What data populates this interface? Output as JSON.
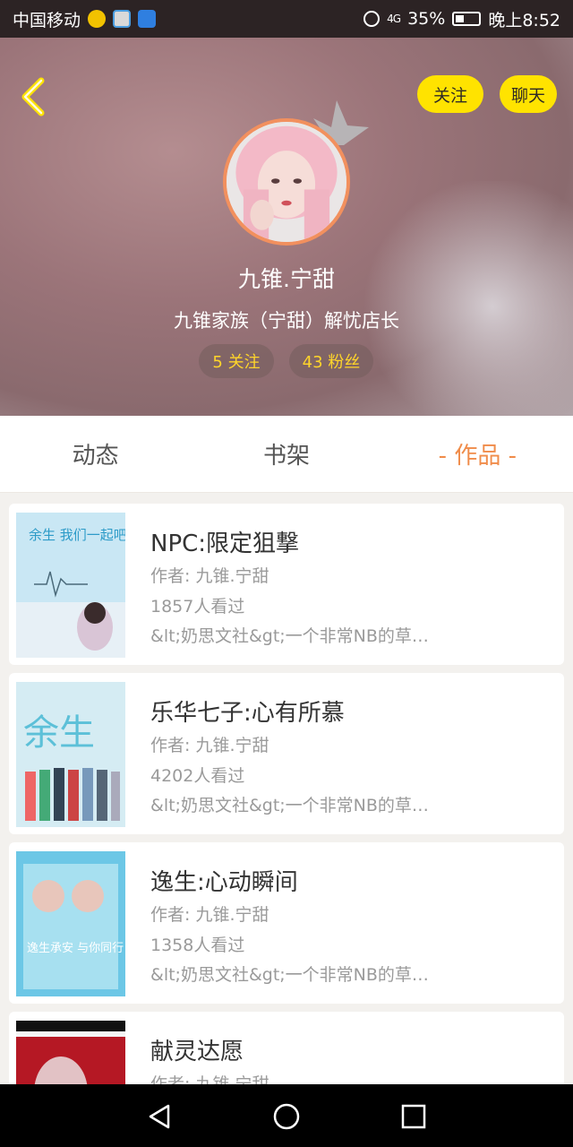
{
  "status_bar": {
    "carrier": "中国移动",
    "battery": "35%",
    "time": "晚上8:52",
    "network": "4G"
  },
  "header": {
    "follow_label": "关注",
    "chat_label": "聊天",
    "name": "九锥.宁甜",
    "title": "九锥家族（宁甜）解忧店长",
    "following": "5 关注",
    "fans": "43 粉丝"
  },
  "tabs": [
    "动态",
    "书架",
    "- 作品 -"
  ],
  "books": [
    {
      "title": "NPC:限定狙撃",
      "author": "作者: 九锥.宁甜",
      "views": "1857人看过",
      "desc": "&lt;奶思文社&gt;一个非常NB的草…",
      "cover_text": "余生 我们一起吧"
    },
    {
      "title": "乐华七子:心有所慕",
      "author": "作者: 九锥.宁甜",
      "views": "4202人看过",
      "desc": "&lt;奶思文社&gt;一个非常NB的草…",
      "cover_text": "余生"
    },
    {
      "title": "逸生:心动瞬间",
      "author": "作者: 九锥.宁甜",
      "views": "1358人看过",
      "desc": "&lt;奶思文社&gt;一个非常NB的草…",
      "cover_text": "逸生承安 与你同行"
    },
    {
      "title": "献灵达愿",
      "author": "作者: 九锥.宁甜",
      "views": "",
      "desc": "",
      "cover_text": ""
    }
  ],
  "colors": {
    "accent": "#f08c4a",
    "button_yellow": "#ffe300",
    "badge_text": "#ffd52a"
  }
}
